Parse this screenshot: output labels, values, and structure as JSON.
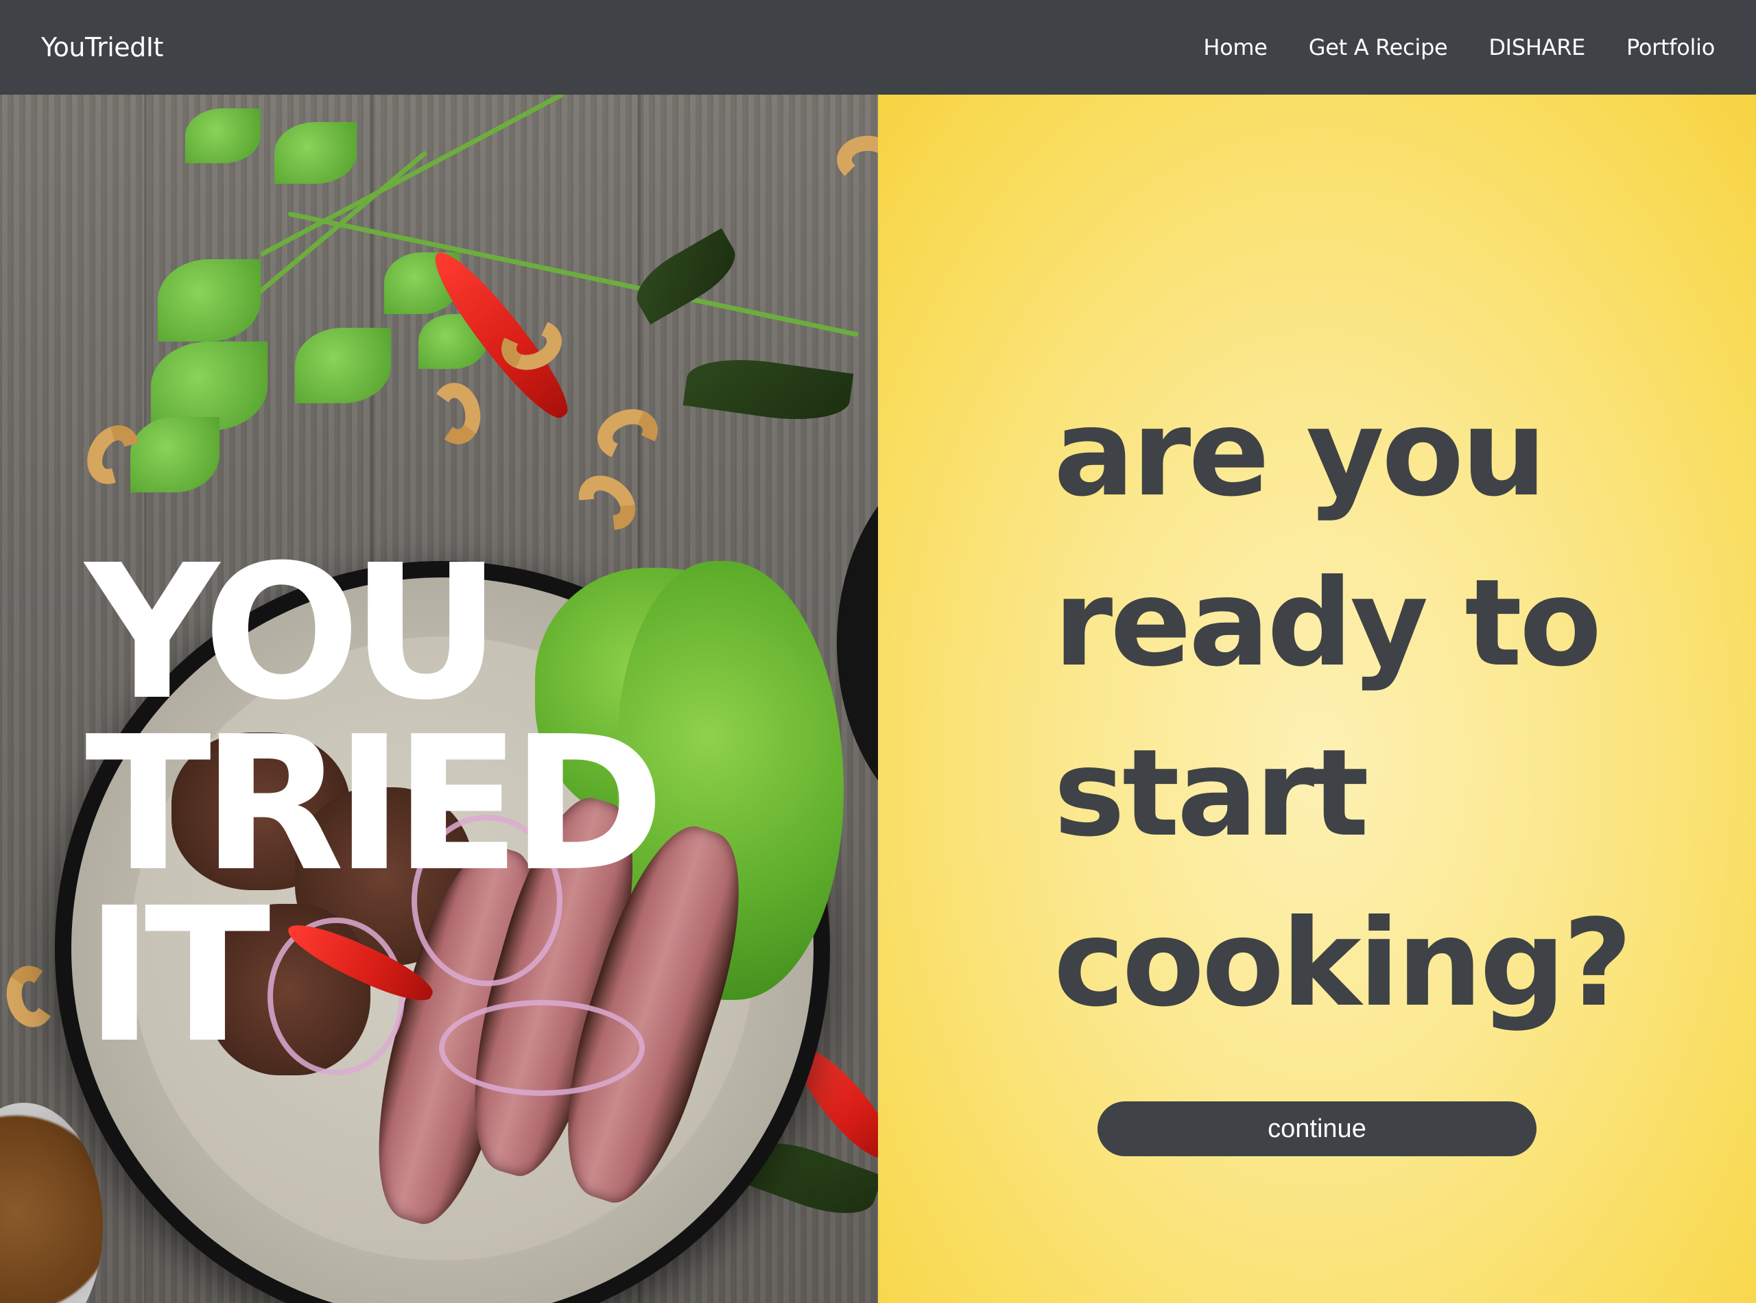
{
  "navbar": {
    "brand": "YouTriedIt",
    "links": [
      "Home",
      "Get A Recipe",
      "DISHARE",
      "Portfolio"
    ]
  },
  "hero": {
    "title_lines": [
      "YOU",
      "TRIED",
      "IT"
    ]
  },
  "cta": {
    "heading_lines": [
      "are you",
      "ready to",
      "start",
      "cooking?"
    ],
    "button_label": "continue"
  },
  "colors": {
    "navbar_bg": "#3f4246",
    "panel_yellow": "#f9dc5a",
    "text_dark": "#3f4246",
    "hero_text": "#ffffff"
  }
}
